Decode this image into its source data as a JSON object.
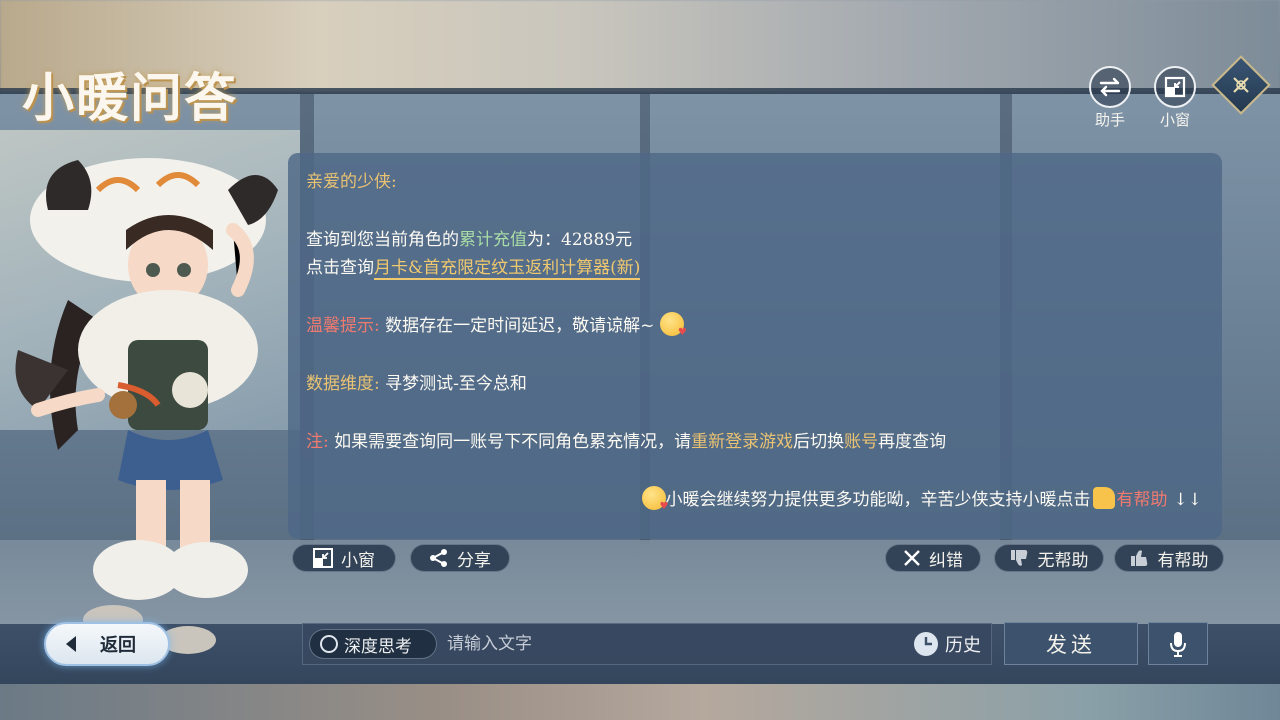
{
  "header": {
    "title": "小暖问答",
    "assistant_label": "助手",
    "mini_window_label": "小窗"
  },
  "chat": {
    "greeting": "亲爱的少侠:",
    "recharge_prefix": "查询到您当前角色的",
    "recharge_highlight": "累计充值",
    "recharge_suffix": "为：42889元",
    "calc_prefix": "点击查询",
    "calc_link": "月卡&首充限定纹玉返利计算器",
    "calc_new": "(新)",
    "tip_label": "温馨提示:",
    "tip_text": "数据存在一定时间延迟，敬请谅解~",
    "dimension_label": "数据维度:",
    "dimension_value": "寻梦测试-至今总和",
    "note_label": "注:",
    "note_text_1": "如果需要查询同一账号下不同角色累充情况，请",
    "note_highlight_1": "重新登录游戏",
    "note_text_2": "后切换",
    "note_highlight_2": "账号",
    "note_text_3": "再度查询",
    "closing_text": "小暖会继续努力提供更多功能呦，辛苦少侠支持小暖点击",
    "closing_highlight": "有帮助",
    "closing_arrows": "↓↓"
  },
  "actions": {
    "mini_window": "小窗",
    "share": "分享",
    "correct": "纠错",
    "not_helpful": "无帮助",
    "helpful": "有帮助"
  },
  "footer": {
    "back_label": "返回",
    "deep_think_label": "深度思考",
    "input_placeholder": "请输入文字",
    "history_label": "历史",
    "send_label": "发送"
  },
  "colors": {
    "accent_gold": "#e9c272",
    "accent_green": "#a8dca6",
    "accent_red": "#f07a6f",
    "panel": "#4e6886"
  }
}
